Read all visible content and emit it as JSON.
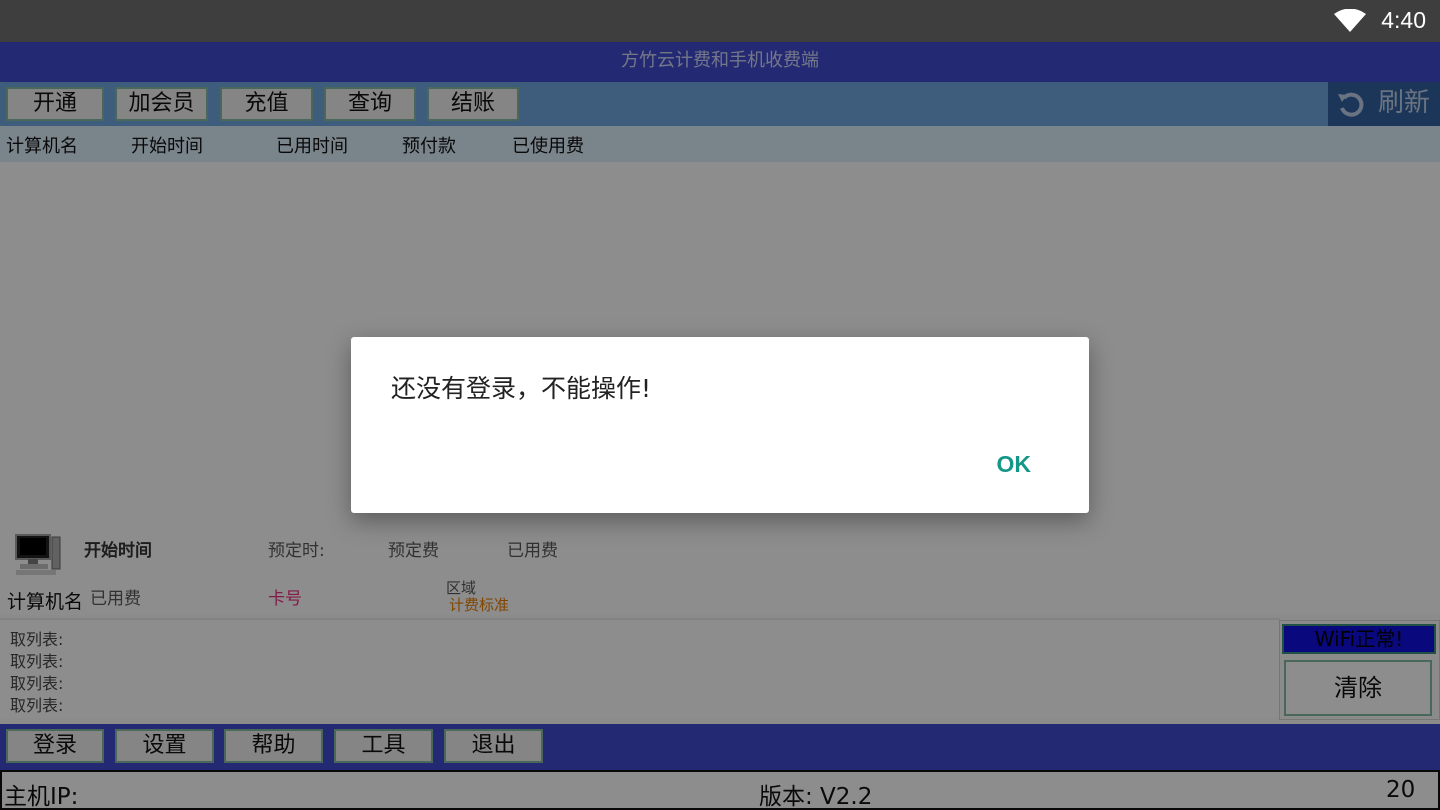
{
  "status_bar": {
    "time": "4:40",
    "wifi_icon": "wifi-icon"
  },
  "window": {
    "title": "方竹云计费和手机收费端"
  },
  "toolbar": {
    "buttons": [
      "开通",
      "加会员",
      "充值",
      "查询",
      "结账"
    ],
    "refresh_label": "刷新",
    "refresh_icon": "refresh-icon"
  },
  "table": {
    "columns": [
      "计算机名",
      "开始时间",
      "已用时间",
      "预付款",
      "已使用费"
    ],
    "rows": []
  },
  "detail": {
    "computer_icon": "computer-icon",
    "start_time": "开始时间",
    "reserved_time": "预定时:",
    "reserved_fee": "预定费",
    "used_fee_top": "已用费",
    "computer_name": "计算机名",
    "used_fee": "已用费",
    "card_no": "卡号",
    "area": "区域",
    "billing_standard": "计费标准"
  },
  "log": {
    "lines": [
      "取列表:",
      "取列表:",
      "取列表:",
      "取列表:"
    ]
  },
  "side_panel": {
    "wifi_status": "WiFi正常!",
    "clear_label": "清除"
  },
  "bottom_bar": {
    "buttons": [
      "登录",
      "设置",
      "帮助",
      "工具",
      "退出"
    ]
  },
  "footer": {
    "host_ip": "主机IP:",
    "version": "版本: V2.2",
    "count": "20"
  },
  "dialog": {
    "message": "还没有登录，不能操作!",
    "ok_label": "OK"
  },
  "colors": {
    "title_bar": "#3f48c8",
    "toolbar": "#6ba0d8",
    "accent_ok": "#159688",
    "card_no": "#e0307a",
    "billing_standard": "#e07800",
    "wifi_box": "#1010d8"
  }
}
